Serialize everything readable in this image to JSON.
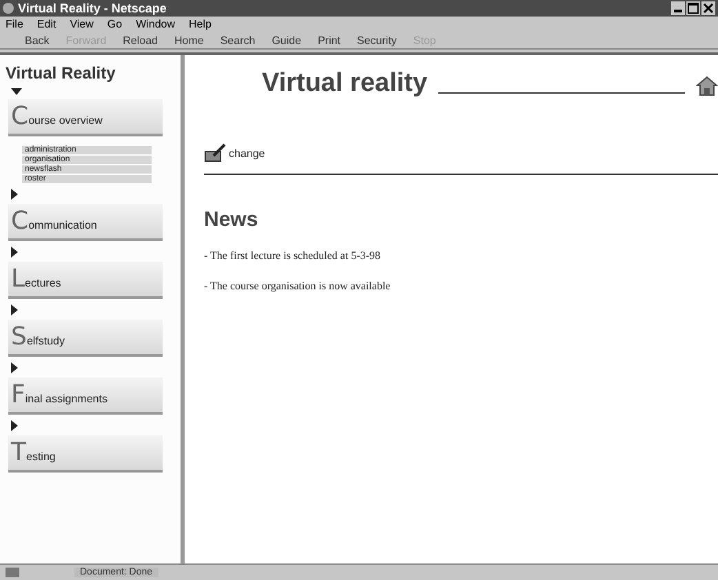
{
  "window": {
    "title": "Virtual Reality - Netscape"
  },
  "menu": [
    "File",
    "Edit",
    "View",
    "Go",
    "Window",
    "Help"
  ],
  "toolbar": [
    {
      "label": "Back",
      "disabled": false
    },
    {
      "label": "Forward",
      "disabled": true
    },
    {
      "label": "Reload",
      "disabled": false
    },
    {
      "label": "Home",
      "disabled": false
    },
    {
      "label": "Search",
      "disabled": false
    },
    {
      "label": "Guide",
      "disabled": false
    },
    {
      "label": "Print",
      "disabled": false
    },
    {
      "label": "Security",
      "disabled": false
    },
    {
      "label": "Stop",
      "disabled": true
    }
  ],
  "sidebar": {
    "title": "Virtual Reality",
    "items": [
      {
        "label": "Course overview",
        "expanded": true,
        "children": [
          "administration",
          "organisation",
          "newsflash",
          "roster"
        ]
      },
      {
        "label": "Communication",
        "expanded": false
      },
      {
        "label": "Lectures",
        "expanded": false
      },
      {
        "label": "Selfstudy",
        "expanded": false
      },
      {
        "label": "Final assignments",
        "expanded": false
      },
      {
        "label": "Testing",
        "expanded": false
      }
    ]
  },
  "page": {
    "title": "Virtual reality",
    "change_link": "change",
    "section_title": "News",
    "news": [
      "- The first lecture is scheduled at 5-3-98",
      "- The course organisation is now available"
    ]
  },
  "status_bar": "Document: Done"
}
